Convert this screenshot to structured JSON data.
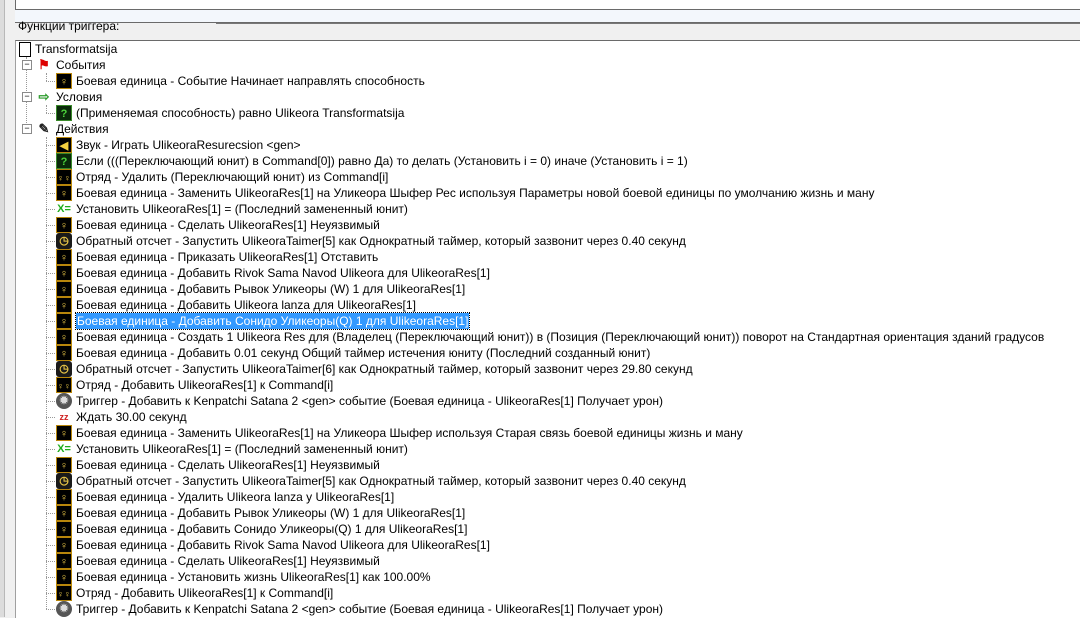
{
  "panel_label": "Функции триггера:",
  "trigger_name": "Transformatsija",
  "sections": [
    {
      "label": "События",
      "icon": "flag-icon",
      "items": [
        {
          "icon": "unit",
          "text": "Боевая единица - Событие Начинает направлять способность"
        }
      ]
    },
    {
      "label": "Условия",
      "icon": "condition-icon",
      "items": [
        {
          "icon": "q",
          "text": "(Применяемая способность) равно Ulikeora Transformatsija"
        }
      ]
    },
    {
      "label": "Действия",
      "icon": "action-icon",
      "items": [
        {
          "icon": "snd",
          "text": "Звук - Играть UlikeoraResurecsion <gen>"
        },
        {
          "icon": "q",
          "text": "Если (((Переключающий юнит) в Command[0]) равно Да) то делать (Установить i = 0) иначе (Установить i = 1)"
        },
        {
          "icon": "grp",
          "text": "Отряд - Удалить (Переключающий юнит) из Command[i]"
        },
        {
          "icon": "unit",
          "text": "Боевая единица - Заменить UlikeoraRes[1] на Уликеора Шыфер Рес используя Параметры новой боевой единицы по умолчанию жизнь и ману"
        },
        {
          "icon": "setv",
          "text": "Установить UlikeoraRes[1] = (Последний замененный юнит)"
        },
        {
          "icon": "unit",
          "text": "Боевая единица - Сделать UlikeoraRes[1] Неуязвимый"
        },
        {
          "icon": "timer",
          "text": "Обратный отсчет - Запустить UlikeoraTaimer[5] как Однократный таймер, который зазвонит через 0.40 секунд"
        },
        {
          "icon": "unit",
          "text": "Боевая единица - Приказать UlikeoraRes[1] Отставить"
        },
        {
          "icon": "unit",
          "text": "Боевая единица - Добавить Rivok Sama Navod Ulikeora  для UlikeoraRes[1]"
        },
        {
          "icon": "unit",
          "text": "Боевая единица - Добавить Рывок Уликеоры (W) 1 для UlikeoraRes[1]"
        },
        {
          "icon": "unit",
          "text": "Боевая единица - Добавить Ulikeora lanza  для UlikeoraRes[1]"
        },
        {
          "icon": "unit",
          "text": "Боевая единица - Добавить Сонидо Уликеоры(Q) 1 для UlikeoraRes[1]",
          "selected": true
        },
        {
          "icon": "unit",
          "text": "Боевая единица - Создать 1 Ulikeora Res для (Владелец (Переключающий юнит)) в (Позиция (Переключающий юнит)) поворот на Стандартная ориентация зданий градусов"
        },
        {
          "icon": "unit",
          "text": "Боевая единица - Добавить 0.01 секунд Общий таймер истечения юниту (Последний созданный юнит)"
        },
        {
          "icon": "timer",
          "text": "Обратный отсчет - Запустить UlikeoraTaimer[6] как Однократный таймер, который зазвонит через 29.80 секунд"
        },
        {
          "icon": "grp",
          "text": "Отряд - Добавить UlikeoraRes[1] к Command[i]"
        },
        {
          "icon": "trig",
          "text": "Триггер - Добавить к Kenpatchi Satana 2 <gen> событие (Боевая единица - UlikeoraRes[1] Получает урон)"
        },
        {
          "icon": "wait",
          "text": "Ждать 30.00 секунд"
        },
        {
          "icon": "unit",
          "text": "Боевая единица - Заменить UlikeoraRes[1] на Уликеора Шыфер используя Старая связь боевой единицы жизнь и ману"
        },
        {
          "icon": "setv",
          "text": "Установить UlikeoraRes[1] = (Последний замененный юнит)"
        },
        {
          "icon": "unit",
          "text": "Боевая единица - Сделать UlikeoraRes[1] Неуязвимый"
        },
        {
          "icon": "timer",
          "text": "Обратный отсчет - Запустить UlikeoraTaimer[5] как Однократный таймер, который зазвонит через 0.40 секунд"
        },
        {
          "icon": "unit",
          "text": "Боевая единица - Удалить Ulikeora lanza  у UlikeoraRes[1]"
        },
        {
          "icon": "unit",
          "text": "Боевая единица - Добавить Рывок Уликеоры (W) 1 для UlikeoraRes[1]"
        },
        {
          "icon": "unit",
          "text": "Боевая единица - Добавить Сонидо Уликеоры(Q) 1 для UlikeoraRes[1]"
        },
        {
          "icon": "unit",
          "text": "Боевая единица - Добавить Rivok Sama Navod Ulikeora  для UlikeoraRes[1]"
        },
        {
          "icon": "unit",
          "text": "Боевая единица - Сделать UlikeoraRes[1] Неуязвимый"
        },
        {
          "icon": "unit",
          "text": "Боевая единица - Установить жизнь UlikeoraRes[1] как 100.00%"
        },
        {
          "icon": "grp",
          "text": "Отряд - Добавить UlikeoraRes[1] к Command[i]"
        },
        {
          "icon": "trig",
          "text": "Триггер - Добавить к Kenpatchi Satana 2 <gen> событие (Боевая единица - UlikeoraRes[1] Получает урон)"
        }
      ]
    }
  ]
}
